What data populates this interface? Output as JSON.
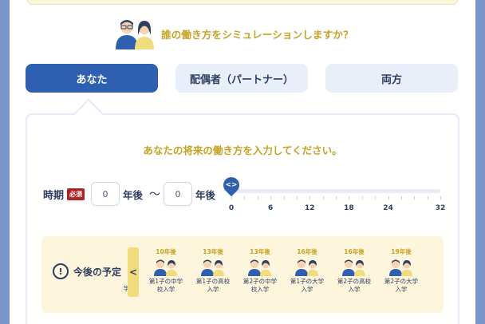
{
  "heading": {
    "text": "誰の働き方をシミュレーションしますか？",
    "icon": "couple-icon"
  },
  "tabs": [
    {
      "label": "あなた",
      "active": true
    },
    {
      "label": "配偶者（パートナー）",
      "active": false
    },
    {
      "label": "両方",
      "active": false
    }
  ],
  "panel": {
    "instruction": "あなたの将来の働き方を入力してください。",
    "period": {
      "label": "時期",
      "required": "必須",
      "start_value": "0",
      "end_value": "0",
      "unit": "年後",
      "separator": "〜"
    },
    "slider": {
      "value": 0,
      "thumb_glyph": "<>",
      "ticks": [
        "0",
        "6",
        "12",
        "18",
        "24",
        "32"
      ]
    },
    "plan": {
      "title": "今後の予定",
      "info_glyph": "!",
      "scroll_glyph": "<",
      "clipped_fragment": "学",
      "events": [
        {
          "years": "10年後",
          "desc": "第1子の中学\n校入学"
        },
        {
          "years": "13年後",
          "desc": "第1子の高校\n入学"
        },
        {
          "years": "13年後",
          "desc": "第2子の中学\n校入学"
        },
        {
          "years": "16年後",
          "desc": "第1子の大学\n入学"
        },
        {
          "years": "16年後",
          "desc": "第2子の高校\n入学"
        },
        {
          "years": "19年後",
          "desc": "第2子の大学\n入学"
        }
      ]
    }
  },
  "colors": {
    "accent": "#2f5fb0",
    "heading": "#c5a323",
    "required": "#b21f24",
    "background": "#7d96c9",
    "plan_bg": "#fdf6dc"
  }
}
